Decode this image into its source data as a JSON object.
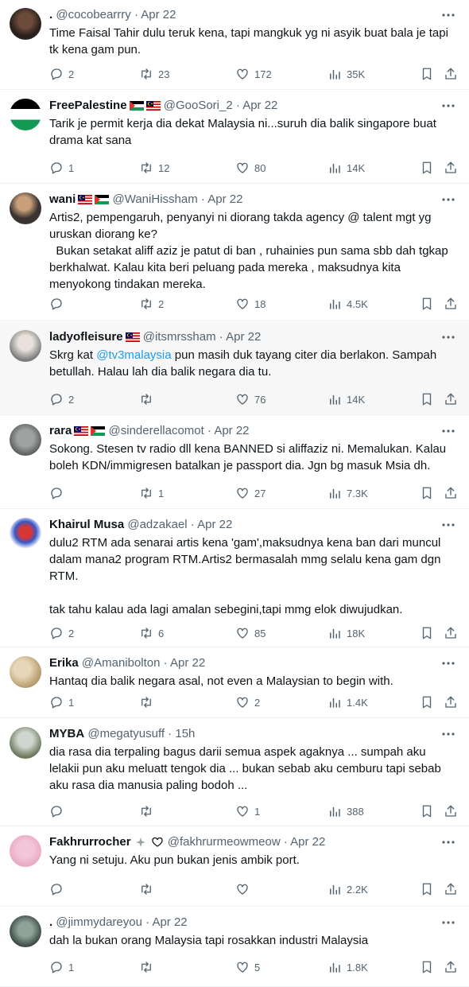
{
  "tweets": [
    {
      "name": ".",
      "flags": [],
      "handle": "@cocobearrry",
      "time": "Apr 22",
      "text": "Time Faisal Tahir dulu teruk kena, tapi mangkuk yg ni asyik buat bala je tapi tk kena gam pun.",
      "replies": "2",
      "retweets": "23",
      "likes": "172",
      "views": "35K"
    },
    {
      "name": "FreePalestine",
      "flags": [
        "palestine",
        "malaysia"
      ],
      "handle": "@GooSori_2",
      "time": "Apr 22",
      "text": "Tarik je permit kerja dia dekat Malaysia ni...suruh dia balik singapore buat drama kat sana",
      "replies": "1",
      "retweets": "12",
      "likes": "80",
      "views": "14K"
    },
    {
      "name": "wani",
      "flags": [
        "malaysia",
        "palestine"
      ],
      "handle": "@WaniHissham",
      "time": "Apr 22",
      "text": "Artis2, pempengaruh, penyanyi ni diorang takda agency @ talent mgt yg uruskan diorang ke?\n  Bukan setakat aliff aziz je patut di ban , ruhainies pun sama sbb dah tgkap berkhalwat. Kalau kita beri peluang pada mereka , maksudnya kita menyokong tindakan mereka.",
      "replies": "",
      "retweets": "2",
      "likes": "18",
      "views": "4.5K"
    },
    {
      "name": "ladyofleisure",
      "flags": [
        "malaysia"
      ],
      "handle": "@itsmrssham",
      "time": "Apr 22",
      "text_pre": "Skrg kat ",
      "mention": "@tv3malaysia",
      "text_post": " pun masih duk tayang citer dia berlakon. Sampah betullah. Halau lah dia balik negara dia tu.",
      "replies": "2",
      "retweets": "",
      "likes": "76",
      "views": "14K"
    },
    {
      "name": "rara",
      "flags": [
        "malaysia",
        "palestine"
      ],
      "handle": "@sinderellacomot",
      "time": "Apr 22",
      "text": "Sokong. Stesen tv radio dll kena BANNED si aliffaziz ni. Memalukan. Kalau boleh KDN/immigresen batalkan je passport dia. Jgn bg masuk Msia dh.",
      "replies": "",
      "retweets": "1",
      "likes": "27",
      "views": "7.3K"
    },
    {
      "name": "Khairul Musa",
      "flags": [],
      "handle": "@adzakael",
      "time": "Apr 22",
      "text": "dulu2 RTM ada senarai artis kena 'gam',maksudnya kena ban dari muncul dalam mana2 program RTM.Artis2 bermasalah mmg selalu kena gam dgn RTM.\n\ntak tahu kalau ada lagi amalan sebegini,tapi mmg elok diwujudkan.",
      "replies": "2",
      "retweets": "6",
      "likes": "85",
      "views": "18K"
    },
    {
      "name": "Erika",
      "flags": [],
      "handle": "@Amanibolton",
      "time": "Apr 22",
      "text": "Hantaq dia balik negara asal, not even a Malaysian to begin with.",
      "replies": "1",
      "retweets": "",
      "likes": "2",
      "views": "1.4K"
    },
    {
      "name": "MYBA",
      "flags": [],
      "handle": "@megatyusuff",
      "time": "15h",
      "text": "dia rasa dia terpaling bagus darii semua aspek agaknya ... sumpah aku lelakii pun aku meluatt tengok dia ... bukan sebab aku cemburu tapi sebab aku rasa dia manusia paling bodoh ...",
      "replies": "",
      "retweets": "",
      "likes": "1",
      "views": "388"
    },
    {
      "name": "Fakhrurrocher",
      "flags": [
        "sparkle",
        "heart"
      ],
      "handle": "@fakhrurmeowmeow",
      "time": "Apr 22",
      "text": "Yang ni setuju. Aku pun bukan jenis ambik port.",
      "replies": "",
      "retweets": "",
      "likes": "",
      "views": "2.2K"
    },
    {
      "name": ".",
      "flags": [],
      "handle": "@jimmydareyou",
      "time": "Apr 22",
      "text": "dah la bukan orang Malaysia tapi rosakkan industri Malaysia",
      "replies": "1",
      "retweets": "",
      "likes": "5",
      "views": "1.8K"
    }
  ],
  "colors": {
    "text": "#0f1419",
    "secondary": "#536471",
    "link": "#1d9bf0",
    "divider": "#eff3f4",
    "highlight": "#f7f7f7"
  },
  "icons": [
    "reply-icon",
    "retweet-icon",
    "like-icon",
    "views-icon",
    "bookmark-icon",
    "share-icon",
    "more-icon"
  ]
}
